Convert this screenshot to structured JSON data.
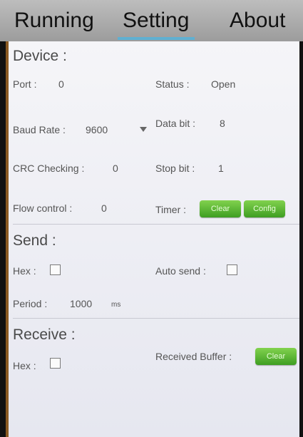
{
  "tabs": {
    "running": "Running",
    "setting": "Setting",
    "about": "About"
  },
  "device": {
    "header": "Device :",
    "port_label": "Port :",
    "port_value": "0",
    "status_label": "Status :",
    "status_value": "Open",
    "baud_label": "Baud Rate :",
    "baud_value": "9600",
    "databit_label": "Data bit :",
    "databit_value": "8",
    "crc_label": "CRC Checking :",
    "crc_value": "0",
    "stopbit_label": "Stop bit :",
    "stopbit_value": "1",
    "flow_label": "Flow control :",
    "flow_value": "0",
    "timer_label": "Timer :",
    "clear_button": "Clear",
    "config_button": "Config"
  },
  "send": {
    "header": "Send :",
    "hex_label": "Hex :",
    "autosend_label": "Auto send :",
    "period_label": "Period :",
    "period_value": "1000",
    "period_unit": "ms"
  },
  "receive": {
    "header": "Receive :",
    "hex_label": "Hex :",
    "buffer_label": "Received Buffer :",
    "clear_button": "Clear"
  },
  "colors": {
    "accent": "#5fb0d2",
    "button_green": "#5cbc36",
    "panel_border": "#8a5a22"
  }
}
